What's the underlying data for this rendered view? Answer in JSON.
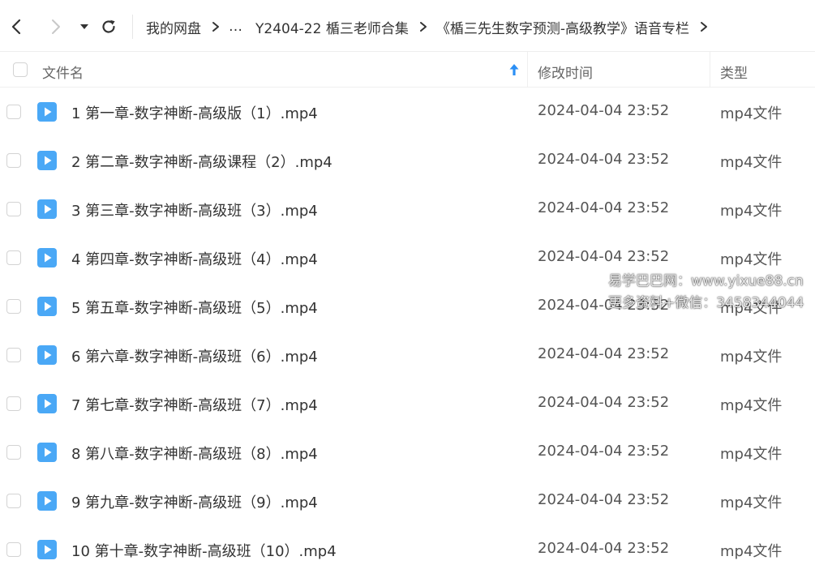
{
  "breadcrumb": {
    "items": [
      "我的网盘",
      "…",
      "Y2404-22 楯三老师合集",
      "《楯三先生数字预测-高级教学》语音专栏"
    ]
  },
  "columns": {
    "name": "文件名",
    "time": "修改时间",
    "type": "类型"
  },
  "files": [
    {
      "name": "1 第一章-数字神断-高级版（1）.mp4",
      "time": "2024-04-04 23:52",
      "type": "mp4文件"
    },
    {
      "name": "2 第二章-数字神断-高级课程（2）.mp4",
      "time": "2024-04-04 23:52",
      "type": "mp4文件"
    },
    {
      "name": "3 第三章-数字神断-高级班（3）.mp4",
      "time": "2024-04-04 23:52",
      "type": "mp4文件"
    },
    {
      "name": "4 第四章-数字神断-高级班（4）.mp4",
      "time": "2024-04-04 23:52",
      "type": "mp4文件"
    },
    {
      "name": "5 第五章-数字神断-高级班（5）.mp4",
      "time": "2024-04-04 23:52",
      "type": "mp4文件"
    },
    {
      "name": "6 第六章-数字神断-高级班（6）.mp4",
      "time": "2024-04-04 23:52",
      "type": "mp4文件"
    },
    {
      "name": "7 第七章-数字神断-高级班（7）.mp4",
      "time": "2024-04-04 23:52",
      "type": "mp4文件"
    },
    {
      "name": "8 第八章-数字神断-高级班（8）.mp4",
      "time": "2024-04-04 23:52",
      "type": "mp4文件"
    },
    {
      "name": "9 第九章-数字神断-高级班（9）.mp4",
      "time": "2024-04-04 23:52",
      "type": "mp4文件"
    },
    {
      "name": "10 第十章-数字神断-高级班（10）.mp4",
      "time": "2024-04-04 23:52",
      "type": "mp4文件"
    }
  ],
  "watermark": {
    "line1": "易学巴巴网：www.yixue88.cn",
    "line2": "更多资料+微信：3458344044"
  },
  "icons": {
    "back": "chevron-left-icon",
    "forward": "chevron-right-icon",
    "dropdown": "caret-down-icon",
    "refresh": "refresh-icon",
    "sort": "arrow-up-icon",
    "file": "video-file-icon"
  },
  "colors": {
    "accent": "#2b8ff5",
    "file_icon": "#4aa8f6",
    "disabled": "#c8c8c8"
  }
}
